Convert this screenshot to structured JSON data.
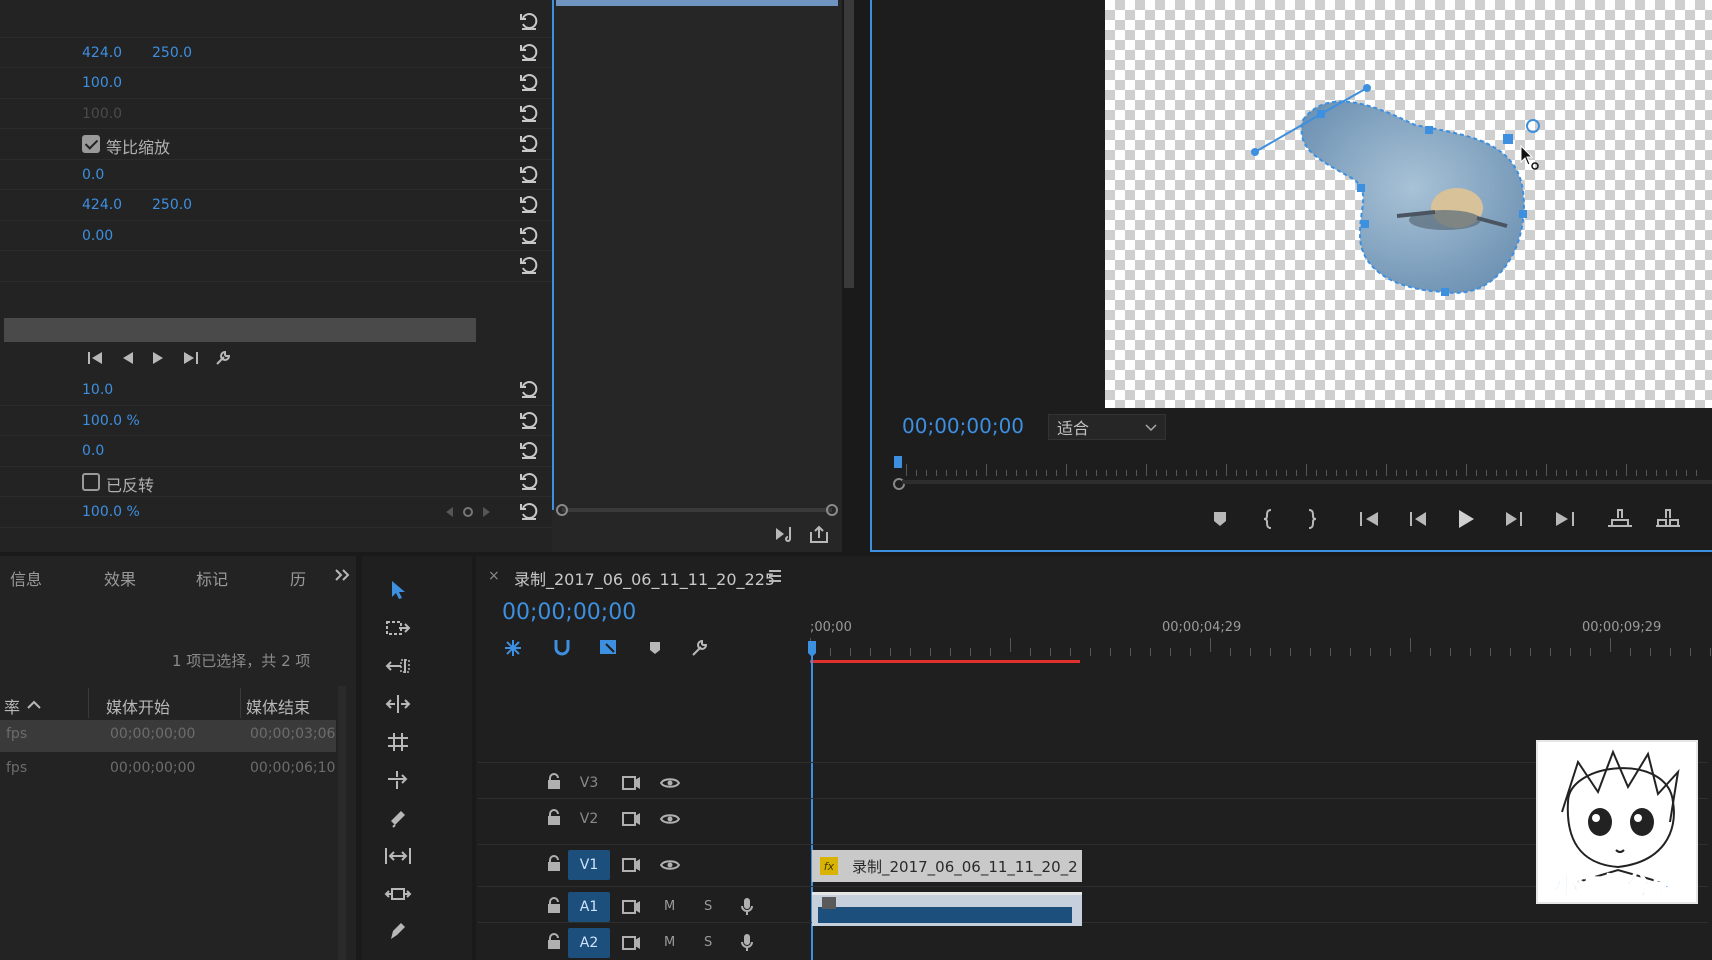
{
  "effect_controls": {
    "rows": [
      {
        "v1": "",
        "v2": ""
      },
      {
        "v1": "424.0",
        "v2": "250.0"
      },
      {
        "v1": "100.0",
        "v2": ""
      },
      {
        "v1": "100.0",
        "v2": "",
        "dim": true
      },
      {
        "checkbox_label": "等比缩放",
        "checked": true
      },
      {
        "v1": "0.0",
        "v2": ""
      },
      {
        "v1": "424.0",
        "v2": "250.0"
      },
      {
        "v1": "0.00",
        "v2": ""
      },
      {
        "v1": "",
        "v2": ""
      }
    ],
    "mask_rows": [
      {
        "v1": "10.0"
      },
      {
        "v1": "100.0 %"
      },
      {
        "v1": "0.0"
      },
      {
        "checkbox_label": "已反转",
        "checked": false
      },
      {
        "v1": "100.0 %"
      }
    ]
  },
  "program_monitor": {
    "timecode": "00;00;00;00",
    "fit_label": "适合"
  },
  "left_panel": {
    "tabs": [
      "信息",
      "效果",
      "标记",
      "历"
    ],
    "selection_info": "1 项已选择，共 2 项",
    "columns": [
      "率",
      "媒体开始",
      "媒体结束"
    ],
    "rows": [
      {
        "rate": "fps",
        "start": "00;00;00;00",
        "end": "00;00;03;06"
      },
      {
        "rate": "fps",
        "start": "00;00;00;00",
        "end": "00;00;06;10"
      }
    ]
  },
  "timeline": {
    "sequence_name": "录制_2017_06_06_11_11_20_225",
    "timecode": "00;00;00;00",
    "ruler": [
      ";00;00",
      "00;00;04;29",
      "00;00;09;29"
    ],
    "tracks": [
      {
        "name": "V3",
        "type": "video",
        "active": false
      },
      {
        "name": "V2",
        "type": "video",
        "active": false
      },
      {
        "name": "V1",
        "type": "video",
        "active": true
      },
      {
        "name": "A1",
        "type": "audio",
        "active": true
      },
      {
        "name": "A2",
        "type": "audio",
        "active": true
      }
    ],
    "audio_m": "M",
    "audio_s": "S",
    "clip_label": "录制_2017_06_06_11_11_20_2"
  },
  "watermark": {
    "text": "小波的分享"
  },
  "colors": {
    "accent": "#3d8fe0",
    "panel": "#232323",
    "playhead": "#e0312e"
  }
}
